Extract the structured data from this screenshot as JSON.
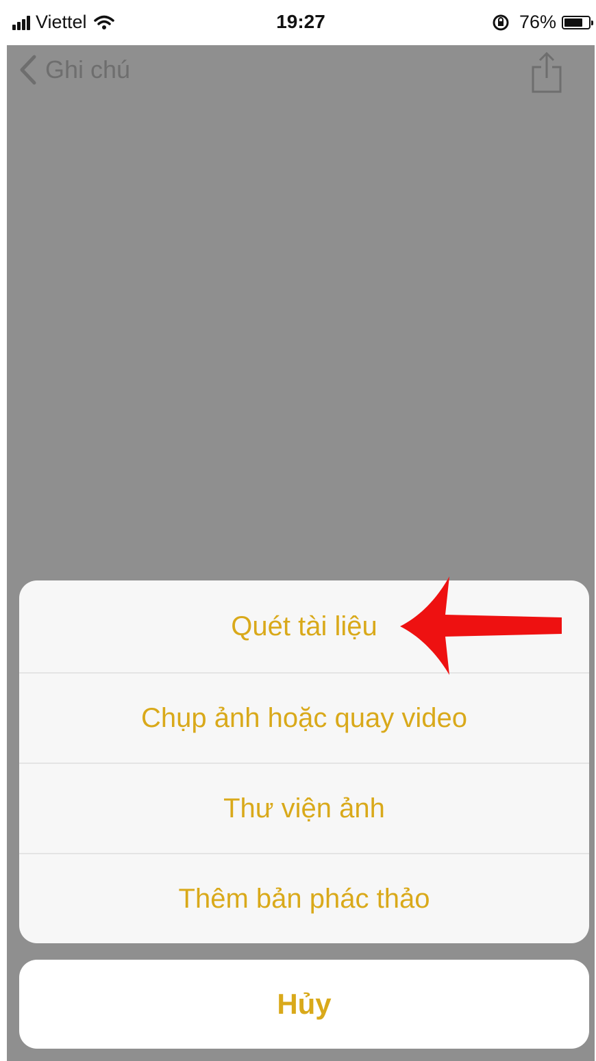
{
  "status_bar": {
    "carrier": "Viettel",
    "time": "19:27",
    "battery": "76%",
    "battery_level": 0.76,
    "icons": [
      "signal-icon",
      "wifi-icon",
      "orientation-lock-icon",
      "battery-icon"
    ]
  },
  "nav": {
    "back_label": "Ghi chú",
    "icons": [
      "chevron-left-icon",
      "share-icon"
    ]
  },
  "action_sheet": {
    "items": [
      {
        "label": "Quét tài liệu"
      },
      {
        "label": "Chụp ảnh hoặc quay video"
      },
      {
        "label": "Thư viện ảnh"
      },
      {
        "label": "Thêm bản phác thảo"
      }
    ],
    "cancel_label": "Hủy"
  },
  "colors": {
    "accent": "#d9a91a",
    "dim_overlay": "#8f8f8f",
    "annotation_arrow": "#ee1111"
  }
}
